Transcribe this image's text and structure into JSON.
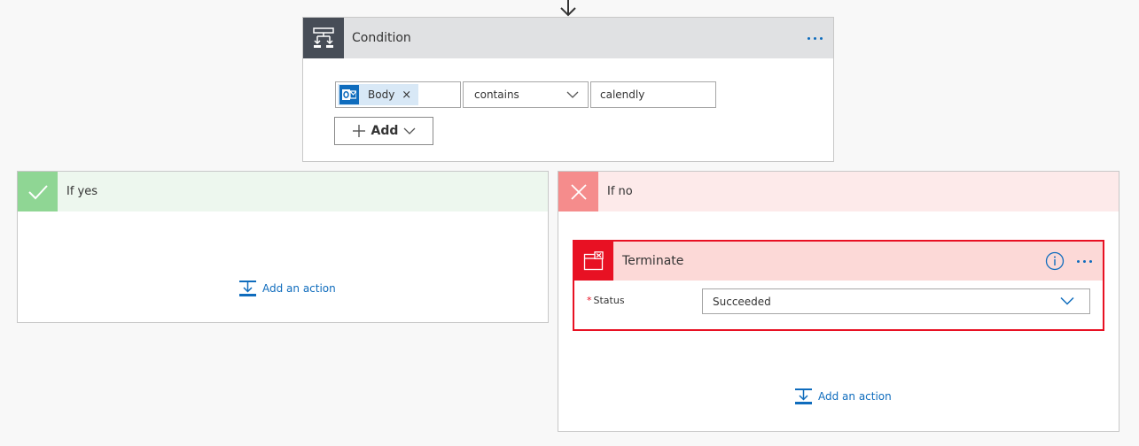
{
  "condition": {
    "title": "Condition",
    "token": {
      "label": "Body",
      "remove_glyph": "×",
      "icon": "outlook-icon"
    },
    "operator": "contains",
    "value": "calendly",
    "add_label": "Add"
  },
  "branch_yes": {
    "title": "If yes",
    "add_action_label": "Add an action"
  },
  "branch_no": {
    "title": "If no",
    "add_action_label": "Add an action",
    "terminate": {
      "title": "Terminate",
      "status_label": "Status",
      "required_marker": "*",
      "status_value": "Succeeded"
    }
  },
  "colors": {
    "accent": "#0f6cbd",
    "yes": "#8fd694",
    "no": "#f58c8c",
    "terminate": "#e81123",
    "condition_icon_bg": "#474d57"
  }
}
